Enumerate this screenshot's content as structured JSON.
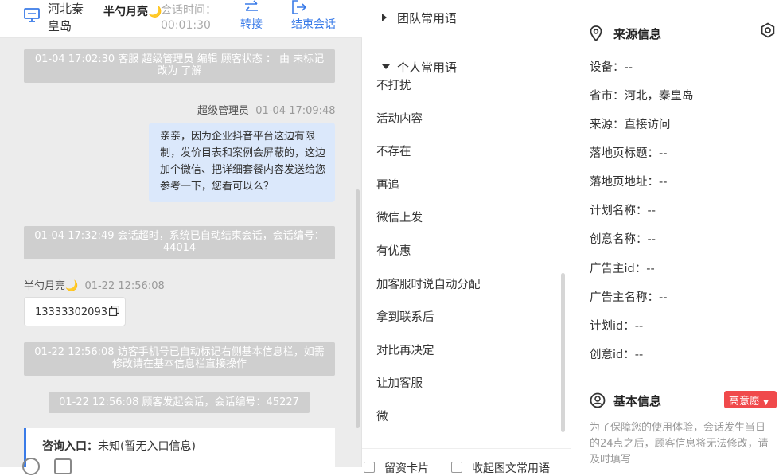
{
  "header": {
    "location": "河北秦皇岛",
    "customer_name": "半勺月亮🌙",
    "time_label": "会话时间：",
    "time_value": "00:01:30",
    "transfer_label": "转接",
    "end_label": "结束会话"
  },
  "chat": {
    "sys1": "01-04 17:02:30 客服 超级管理员 编辑 顾客状态 ： 由 未标记 改为 了解",
    "agent_name": "超级管理员",
    "agent_time": "01-04 17:09:48",
    "bubble": "亲亲，因为企业抖音平台这边有限制，发价目表和案例会屏蔽的，这边加个微信、把详细套餐内容发送给您参考一下，您看可以么？",
    "sys2": "01-04 17:32:49 会话超时，系统已自动结束会话，会话编号：44014",
    "customer_name": "半勺月亮🌙",
    "customer_time": "01-22 12:56:08",
    "phone": "13333302093",
    "sys3": "01-22 12:56:08 访客手机号已自动标记右侧基本信息栏，如需修改请在基本信息栏直接操作",
    "sys4": "01-22 12:56:08 顾客发起会话，会话编号：45227",
    "entry_label": "咨询入口：",
    "entry_value": "未知(暂无入口信息)"
  },
  "phrases": {
    "team_group": "团队常用语",
    "my_group": "个人常用语",
    "items": [
      "不打扰",
      "活动内容",
      "不存在",
      "再追",
      "微信上发",
      "有优惠",
      "加客服时说自动分配",
      "拿到联系后",
      "对比再决定",
      "让加客服",
      "微"
    ],
    "bottom_left": "留资卡片",
    "bottom_right": "收起图文常用语"
  },
  "info": {
    "source_title": "来源信息",
    "rows": [
      "设备：--",
      "省市：河北，秦皇岛",
      "来源：直接访问",
      "落地页标题：--",
      "落地页地址：--",
      "计划名称：--",
      "创意名称：--",
      "广告主id：--",
      "广告主名称：--",
      "计划id：--",
      "创意id：--"
    ],
    "basic_title": "基本信息",
    "intent_tag": "高意愿",
    "note": "为了保障您的使用体验，会话发生当日的24点之后，顾客信息将无法修改，请及时填写"
  }
}
